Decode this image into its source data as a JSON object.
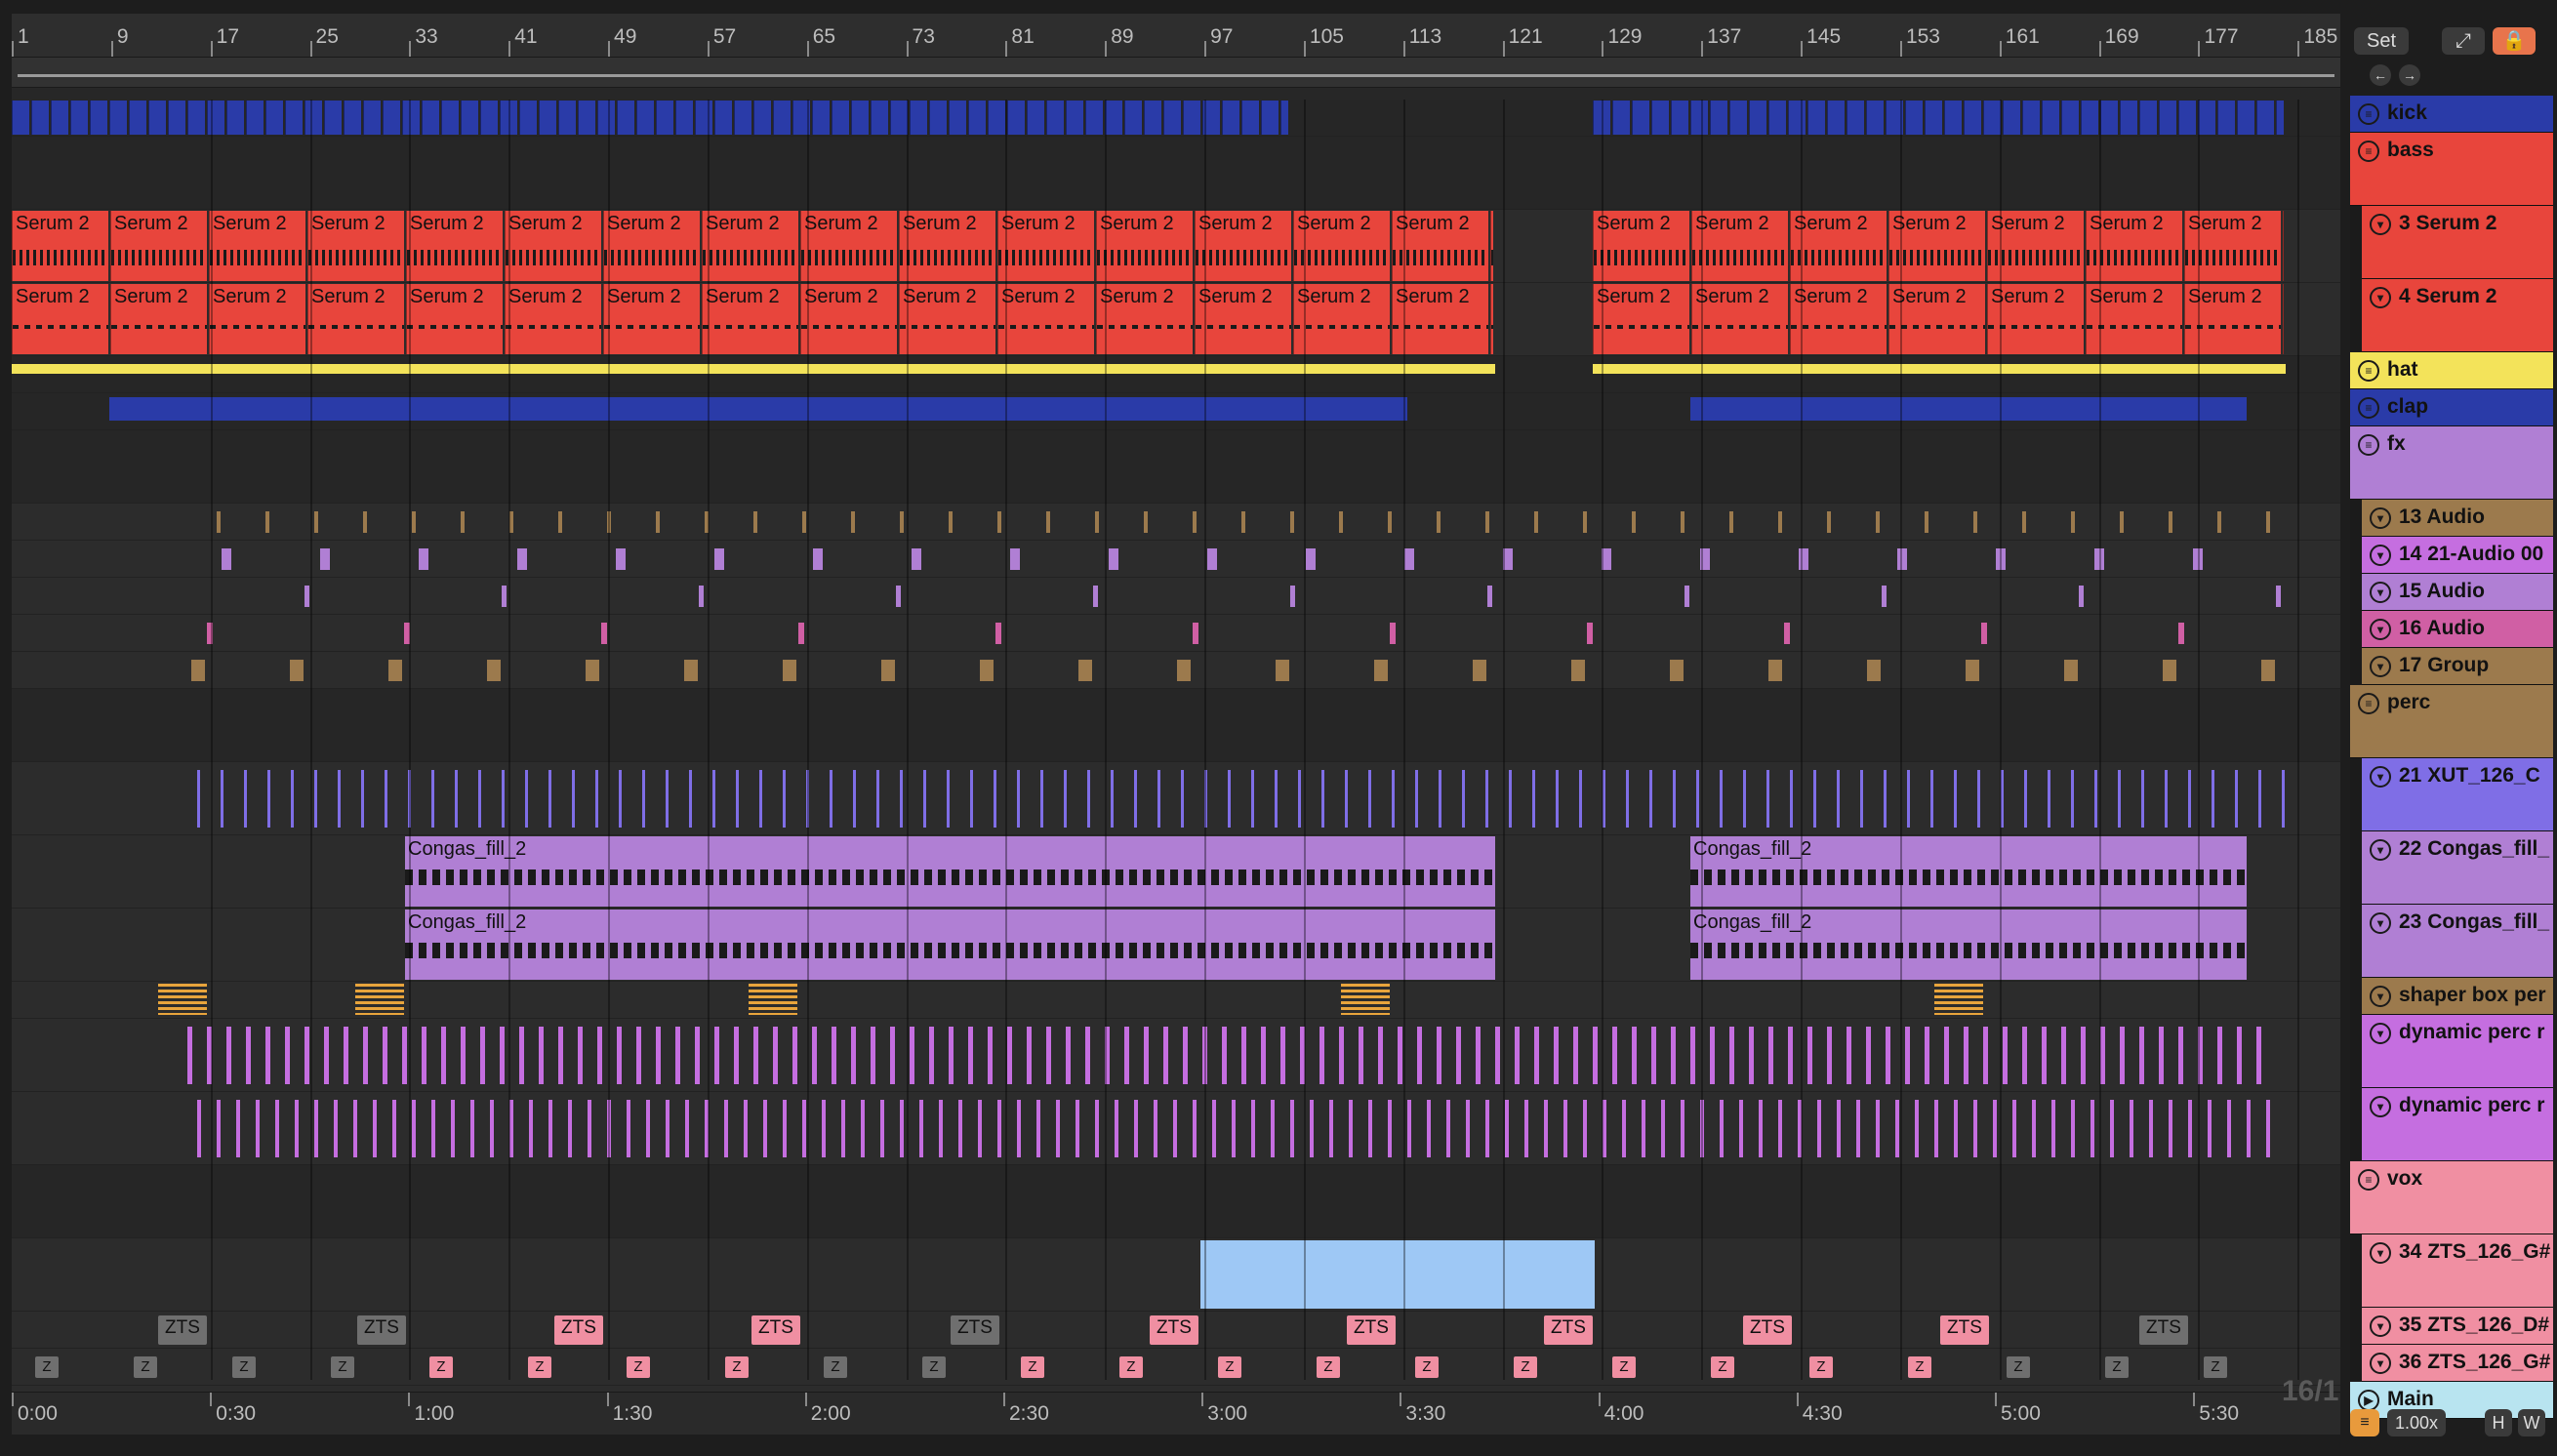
{
  "set_button": "Set",
  "grid_label": "16/1",
  "zoom": "1.00x",
  "bottom_buttons": {
    "h": "H",
    "w": "W"
  },
  "colors": {
    "blue": "#2a3ba8",
    "red": "#e8453c",
    "yellow": "#f3e35a",
    "purple": "#b07fd4",
    "violet": "#7f6ee6",
    "pink": "#f08fa2",
    "brown": "#9c7a4d",
    "lightblue": "#9ec8f5",
    "grey": "#6f6f6f"
  },
  "ruler": [
    "1",
    "9",
    "17",
    "25",
    "33",
    "41",
    "49",
    "57",
    "65",
    "73",
    "81",
    "89",
    "97",
    "105",
    "113",
    "121",
    "129",
    "137",
    "145",
    "153",
    "161",
    "169",
    "177",
    "185"
  ],
  "timeline": [
    "0:00",
    "0:30",
    "1:00",
    "1:30",
    "2:00",
    "2:30",
    "3:00",
    "3:30",
    "4:00",
    "4:30",
    "5:00",
    "5:30"
  ],
  "clip_labels": {
    "serum": "Serum 2",
    "congas": "Congas_fill_2",
    "zts": "ZTS",
    "z": "Z"
  },
  "tracks": [
    {
      "name": "kick",
      "type": "group"
    },
    {
      "name": "bass",
      "type": "group"
    },
    {
      "name": "3 Serum 2",
      "type": "sub"
    },
    {
      "name": "4 Serum 2",
      "type": "sub"
    },
    {
      "name": "hat",
      "type": "group"
    },
    {
      "name": "clap",
      "type": "group"
    },
    {
      "name": "fx",
      "type": "group"
    },
    {
      "name": "13 Audio",
      "type": "sub"
    },
    {
      "name": "14 21-Audio 00",
      "type": "sub"
    },
    {
      "name": "15 Audio",
      "type": "sub"
    },
    {
      "name": "16 Audio",
      "type": "sub"
    },
    {
      "name": "17 Group",
      "type": "sub"
    },
    {
      "name": "perc",
      "type": "group"
    },
    {
      "name": "21 XUT_126_C",
      "type": "sub"
    },
    {
      "name": "22 Congas_fill_",
      "type": "sub"
    },
    {
      "name": "23 Congas_fill_",
      "type": "sub"
    },
    {
      "name": "shaper box per",
      "type": "sub"
    },
    {
      "name": "dynamic perc r",
      "type": "sub"
    },
    {
      "name": "dynamic perc r",
      "type": "sub"
    },
    {
      "name": "vox",
      "type": "group"
    },
    {
      "name": "34 ZTS_126_G#",
      "type": "sub"
    },
    {
      "name": "35 ZTS_126_D#",
      "type": "sub"
    },
    {
      "name": "36 ZTS_126_G#",
      "type": "sub"
    },
    {
      "name": "Main",
      "type": "main"
    }
  ]
}
